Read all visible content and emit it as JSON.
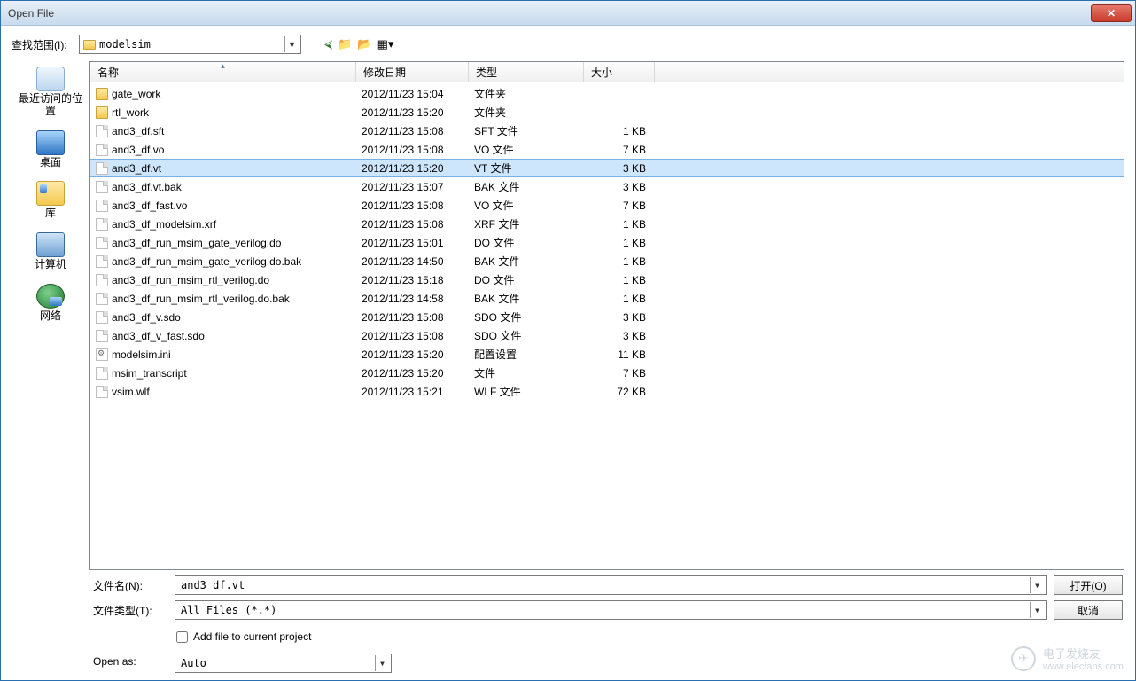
{
  "window": {
    "title": "Open File"
  },
  "lookup": {
    "label": "查找范围(I):",
    "value": "modelsim"
  },
  "nav_icons": {
    "back": "back-icon",
    "up": "up-icon",
    "newfolder": "new-folder-icon",
    "view": "view-menu-icon"
  },
  "places": [
    {
      "id": "recent",
      "label": "最近访问的位置"
    },
    {
      "id": "desktop",
      "label": "桌面"
    },
    {
      "id": "libraries",
      "label": "库"
    },
    {
      "id": "computer",
      "label": "计算机"
    },
    {
      "id": "network",
      "label": "网络"
    }
  ],
  "columns": {
    "name": "名称",
    "date": "修改日期",
    "type": "类型",
    "size": "大小"
  },
  "files": [
    {
      "icon": "folder",
      "name": "gate_work",
      "date": "2012/11/23 15:04",
      "type": "文件夹",
      "size": "",
      "selected": false
    },
    {
      "icon": "folder",
      "name": "rtl_work",
      "date": "2012/11/23 15:20",
      "type": "文件夹",
      "size": "",
      "selected": false
    },
    {
      "icon": "file",
      "name": "and3_df.sft",
      "date": "2012/11/23 15:08",
      "type": "SFT 文件",
      "size": "1 KB",
      "selected": false
    },
    {
      "icon": "file",
      "name": "and3_df.vo",
      "date": "2012/11/23 15:08",
      "type": "VO 文件",
      "size": "7 KB",
      "selected": false
    },
    {
      "icon": "file",
      "name": "and3_df.vt",
      "date": "2012/11/23 15:20",
      "type": "VT 文件",
      "size": "3 KB",
      "selected": true
    },
    {
      "icon": "file",
      "name": "and3_df.vt.bak",
      "date": "2012/11/23 15:07",
      "type": "BAK 文件",
      "size": "3 KB",
      "selected": false
    },
    {
      "icon": "file",
      "name": "and3_df_fast.vo",
      "date": "2012/11/23 15:08",
      "type": "VO 文件",
      "size": "7 KB",
      "selected": false
    },
    {
      "icon": "file",
      "name": "and3_df_modelsim.xrf",
      "date": "2012/11/23 15:08",
      "type": "XRF 文件",
      "size": "1 KB",
      "selected": false
    },
    {
      "icon": "file",
      "name": "and3_df_run_msim_gate_verilog.do",
      "date": "2012/11/23 15:01",
      "type": "DO 文件",
      "size": "1 KB",
      "selected": false
    },
    {
      "icon": "file",
      "name": "and3_df_run_msim_gate_verilog.do.bak",
      "date": "2012/11/23 14:50",
      "type": "BAK 文件",
      "size": "1 KB",
      "selected": false
    },
    {
      "icon": "file",
      "name": "and3_df_run_msim_rtl_verilog.do",
      "date": "2012/11/23 15:18",
      "type": "DO 文件",
      "size": "1 KB",
      "selected": false
    },
    {
      "icon": "file",
      "name": "and3_df_run_msim_rtl_verilog.do.bak",
      "date": "2012/11/23 14:58",
      "type": "BAK 文件",
      "size": "1 KB",
      "selected": false
    },
    {
      "icon": "file",
      "name": "and3_df_v.sdo",
      "date": "2012/11/23 15:08",
      "type": "SDO 文件",
      "size": "3 KB",
      "selected": false
    },
    {
      "icon": "file",
      "name": "and3_df_v_fast.sdo",
      "date": "2012/11/23 15:08",
      "type": "SDO 文件",
      "size": "3 KB",
      "selected": false
    },
    {
      "icon": "ini",
      "name": "modelsim.ini",
      "date": "2012/11/23 15:20",
      "type": "配置设置",
      "size": "11 KB",
      "selected": false
    },
    {
      "icon": "file",
      "name": "msim_transcript",
      "date": "2012/11/23 15:20",
      "type": "文件",
      "size": "7 KB",
      "selected": false
    },
    {
      "icon": "file",
      "name": "vsim.wlf",
      "date": "2012/11/23 15:21",
      "type": "WLF 文件",
      "size": "72 KB",
      "selected": false
    }
  ],
  "filename": {
    "label": "文件名(N):",
    "value": "and3_df.vt"
  },
  "filetype": {
    "label": "文件类型(T):",
    "value": "All Files (*.*)"
  },
  "buttons": {
    "open": "打开(O)",
    "cancel": "取消"
  },
  "checkbox": {
    "label": "Add file to current project",
    "checked": false
  },
  "openas": {
    "label": "Open as:",
    "value": "Auto"
  },
  "watermark": {
    "brand": "电子发烧友",
    "url": "www.elecfans.com"
  }
}
